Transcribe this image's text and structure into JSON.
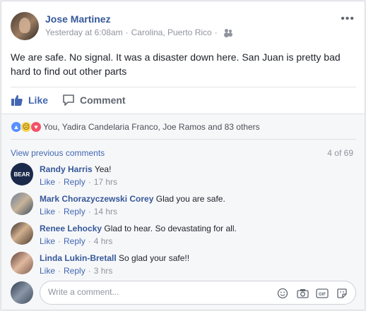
{
  "post": {
    "author": "Jose Martinez",
    "timestamp": "Yesterday at 6:08am",
    "separator": "·",
    "location": "Carolina, Puerto Rico",
    "separator2": "·",
    "audience_icon": "friends-icon",
    "text": "We are safe. No signal. It was a disaster down here. San Juan is pretty bad hard to find out other parts"
  },
  "actions": {
    "like_label": "Like",
    "comment_label": "Comment"
  },
  "reactions": {
    "icons": [
      "like-icon",
      "sad-icon",
      "love-icon"
    ],
    "summary": "You, Yadira Candelaria Franco, Joe Ramos and 83 others"
  },
  "comments_section": {
    "view_previous": "View previous comments",
    "count": "4 of 69",
    "items": [
      {
        "name": "Randy Harris",
        "text": "Yea!",
        "like": "Like",
        "reply": "Reply",
        "time": "17 hrs"
      },
      {
        "name": "Mark Chorazyczewski Corey",
        "text": "Glad you are safe.",
        "like": "Like",
        "reply": "Reply",
        "time": "14 hrs"
      },
      {
        "name": "Renee Lehocky",
        "text": "Glad to hear. So devastating for all.",
        "like": "Like",
        "reply": "Reply",
        "time": "4 hrs"
      },
      {
        "name": "Linda Lukin-Bretall",
        "text": "So glad your safe!!",
        "like": "Like",
        "reply": "Reply",
        "time": "3 hrs"
      }
    ],
    "avatar_text_0": "BEAR"
  },
  "composer": {
    "placeholder": "Write a comment...",
    "tools": [
      "emoji-icon",
      "camera-icon",
      "gif-icon",
      "sticker-icon"
    ]
  },
  "colors": {
    "link": "#365899",
    "accent": "#4267b2",
    "muted": "#90949c"
  }
}
